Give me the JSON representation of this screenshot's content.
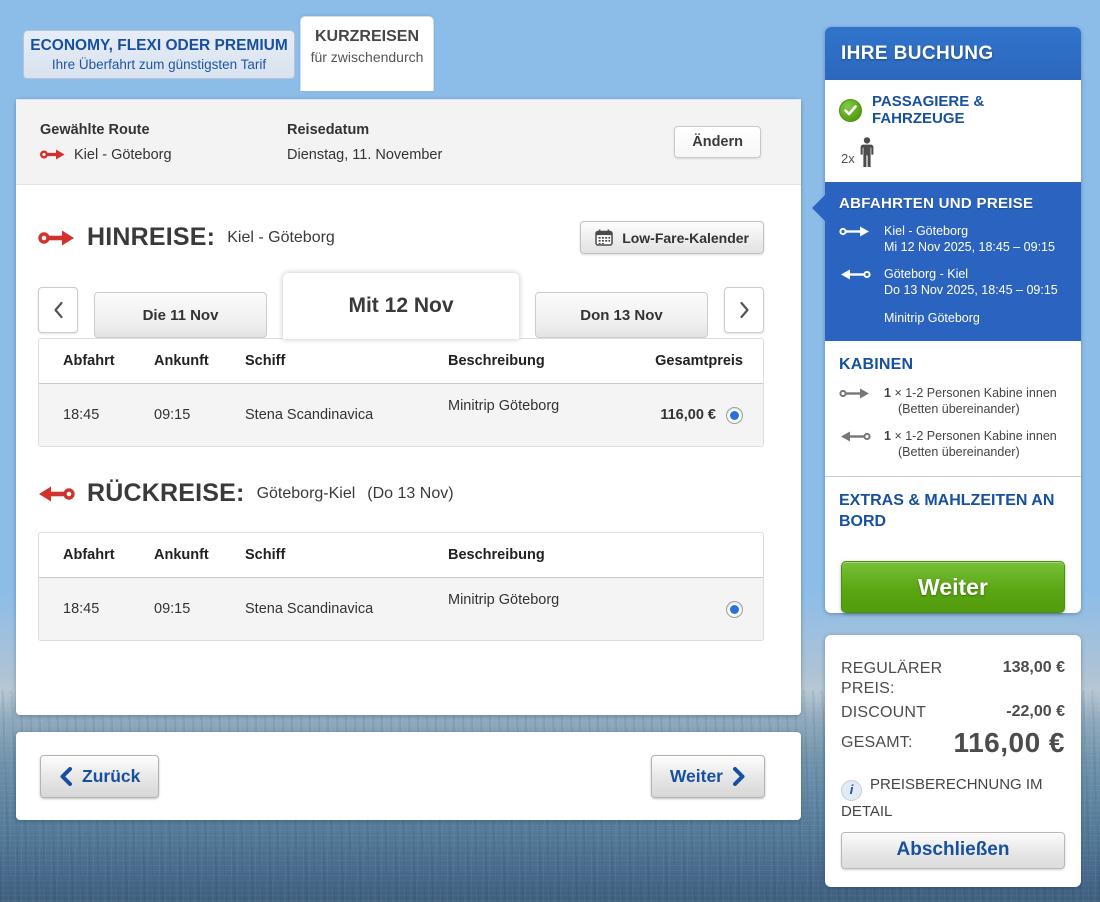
{
  "tariff_tabs": {
    "economy_title": "ECONOMY, FLEXI ODER PREMIUM",
    "economy_subtitle": "Ihre Überfahrt zum günstigsten Tarif",
    "kurzreisen_title": "KURZREISEN",
    "kurzreisen_subtitle": "für zwischendurch"
  },
  "route_bar": {
    "route_label": "Gewählte Route",
    "route_value": "Kiel - Göteborg",
    "date_label": "Reisedatum",
    "date_value": "Dienstag, 11. November",
    "change_button": "Ändern"
  },
  "outbound": {
    "title": "HINREISE:",
    "route": "Kiel - Göteborg",
    "lowfare_button": "Low-Fare-Kalender",
    "day_tabs": [
      "Die 11 Nov",
      "Mit 12 Nov",
      "Don 13 Nov"
    ],
    "columns": [
      "Abfahrt",
      "Ankunft",
      "Schiff",
      "Beschreibung",
      "Gesamtpreis"
    ],
    "row": {
      "departure": "18:45",
      "arrival": "09:15",
      "ship": "Stena Scandinavica",
      "description": "Minitrip Göteborg",
      "price": "116,00 €"
    }
  },
  "inbound": {
    "title": "RÜCKREISE:",
    "route": "Göteborg-Kiel",
    "date_note": "(Do 13 Nov)",
    "columns": [
      "Abfahrt",
      "Ankunft",
      "Schiff",
      "Beschreibung"
    ],
    "row": {
      "departure": "18:45",
      "arrival": "09:15",
      "ship": "Stena Scandinavica",
      "description": "Minitrip Göteborg"
    }
  },
  "footer_nav": {
    "back_button": "Zurück",
    "next_button": "Weiter"
  },
  "booking": {
    "title": "IHRE BUCHUNG",
    "passengers_title": "PASSAGIERE & FAHRZEUGE",
    "passenger_count": "2x",
    "departures_title": "ABFAHRTEN UND PREISE",
    "departures": [
      {
        "route": "Kiel - Göteborg",
        "datetime": "Mi 12 Nov 2025, 18:45 – 09:15"
      },
      {
        "route": "Göteborg - Kiel",
        "datetime": "Do 13 Nov 2025, 18:45 – 09:15"
      }
    ],
    "departures_note": "Minitrip Göteborg",
    "cabins_title": "KABINEN",
    "cabins": [
      {
        "qty": "1",
        "mult": "×",
        "name": "1-2 Personen Kabine innen",
        "detail": "(Betten übereinander)"
      },
      {
        "qty": "1",
        "mult": "×",
        "name": "1-2 Personen Kabine innen",
        "detail": "(Betten übereinander)"
      }
    ],
    "extras_title": "EXTRAS & MAHLZEITEN AN BORD",
    "continue_button": "Weiter"
  },
  "price_summary": {
    "regular_label": "REGULÄRER PREIS:",
    "regular_value": "138,00 €",
    "discount_label": "DISCOUNT",
    "discount_value": "-22,00 €",
    "total_label": "GESAMT:",
    "total_value": "116,00 €",
    "detail_link": "PREISBERECHNUNG IM DETAIL",
    "finish_button": "Abschließen"
  },
  "icons": {
    "info_glyph": "i"
  },
  "colors": {
    "brand_blue": "#2d6ec5",
    "panel_blue": "#2b63c1",
    "link_blue": "#17509f",
    "action_green": "#5aa313",
    "route_red": "#d2322d",
    "sky": "#8cbde9"
  }
}
